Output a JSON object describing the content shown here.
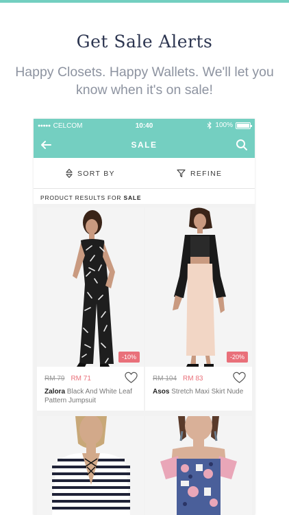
{
  "headline": "Get Sale Alerts",
  "subline": "Happy Closets. Happy Wallets. We'll let you know when it's on sale!",
  "status_bar": {
    "carrier": "CELCOM",
    "time": "10:40",
    "battery": "100%"
  },
  "nav": {
    "title": "SALE",
    "back_icon": "back-arrow-icon",
    "search_icon": "search-icon"
  },
  "toolbar": {
    "sort_label": "SORT BY",
    "refine_label": "REFINE"
  },
  "results": {
    "prefix": "PRODUCT RESULTS FOR",
    "query": "SALE"
  },
  "products": [
    {
      "old_price": "RM 79",
      "new_price": "RM 71",
      "discount": "-10%",
      "brand": "Zalora",
      "name": "Black And White Leaf Pattern Jumpsuit"
    },
    {
      "old_price": "RM 104",
      "new_price": "RM 83",
      "discount": "-20%",
      "brand": "Asos",
      "name": "Stretch Maxi Skirt Nude"
    }
  ],
  "colors": {
    "accent": "#74cfc1",
    "sale": "#e9707a",
    "headline": "#2c3550"
  }
}
